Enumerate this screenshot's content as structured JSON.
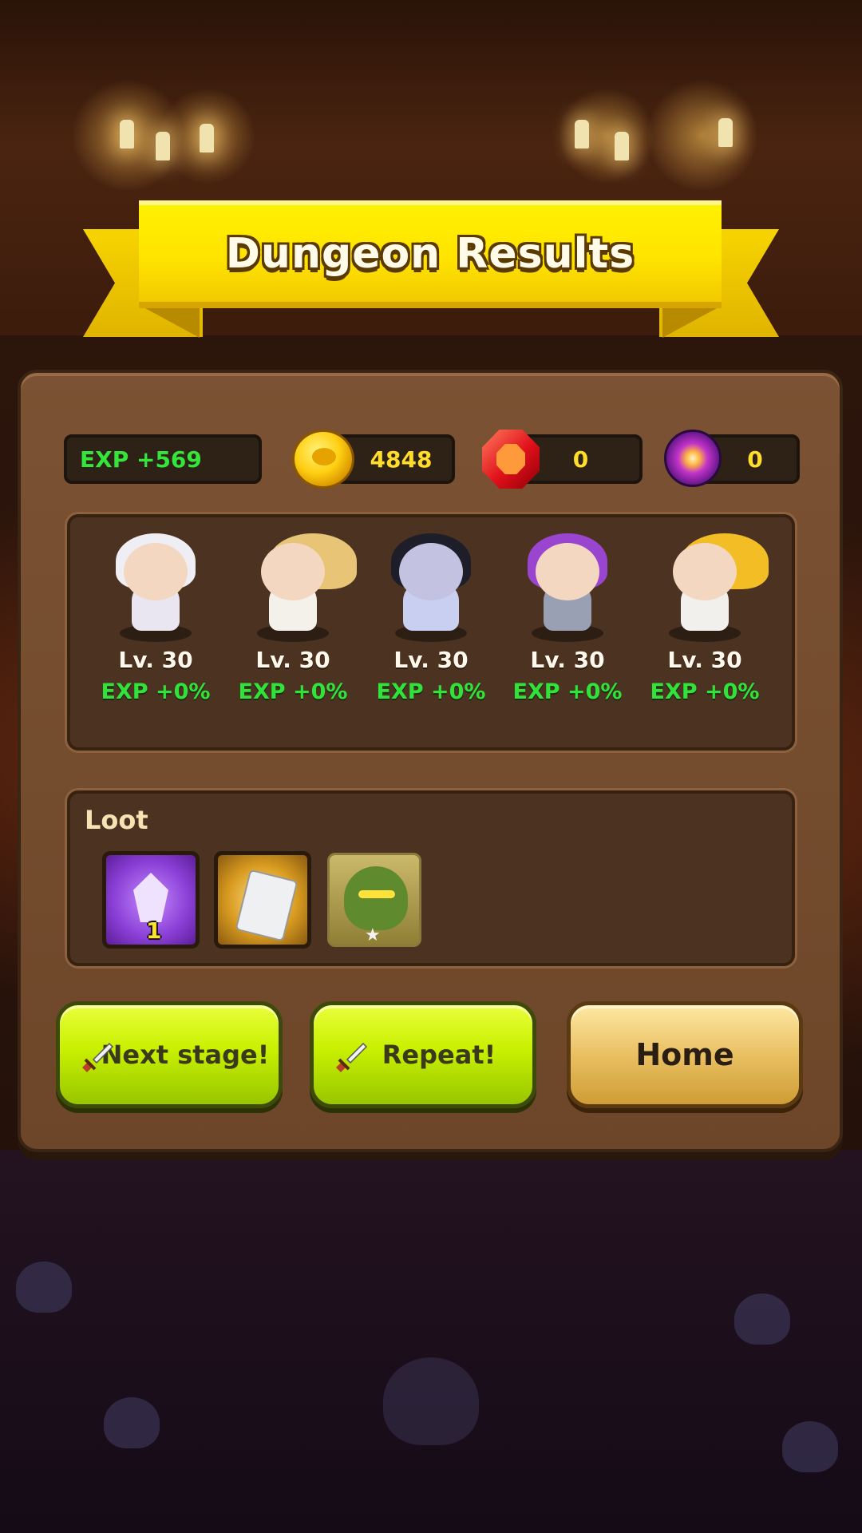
{
  "screen": {
    "title": "Dungeon Results"
  },
  "currencies": {
    "exp": "EXP +569",
    "gold": "4848",
    "gems": "0",
    "orbs": "0"
  },
  "heroes": [
    {
      "name": "white-haired-mage",
      "level": "Lv. 30",
      "exp": "EXP +0%",
      "color": "#e8e8f0"
    },
    {
      "name": "blonde-trident-warrior",
      "level": "Lv. 30",
      "exp": "EXP +0%",
      "color": "#f0cf7a"
    },
    {
      "name": "ghost-girl",
      "level": "Lv. 30",
      "exp": "EXP +0%",
      "color": "#c8ccef"
    },
    {
      "name": "purple-haired-knight",
      "level": "Lv. 30",
      "exp": "EXP +0%",
      "color": "#9a4fd0"
    },
    {
      "name": "blonde-staff-priestess",
      "level": "Lv. 30",
      "exp": "EXP +0%",
      "color": "#f3c02a"
    }
  ],
  "loot": {
    "label": "Loot",
    "items": [
      {
        "name": "purple-crystal",
        "qty": "1"
      },
      {
        "name": "white-card"
      },
      {
        "name": "goblin-card"
      }
    ]
  },
  "buttons": {
    "next_stage": "Next stage!",
    "repeat": "Repeat!",
    "home": "Home"
  },
  "colors": {
    "exp_green": "#31e23b",
    "gold_yellow": "#ffdd2a",
    "banner_yellow": "#ffe400",
    "panel_brown": "#7b5233"
  }
}
